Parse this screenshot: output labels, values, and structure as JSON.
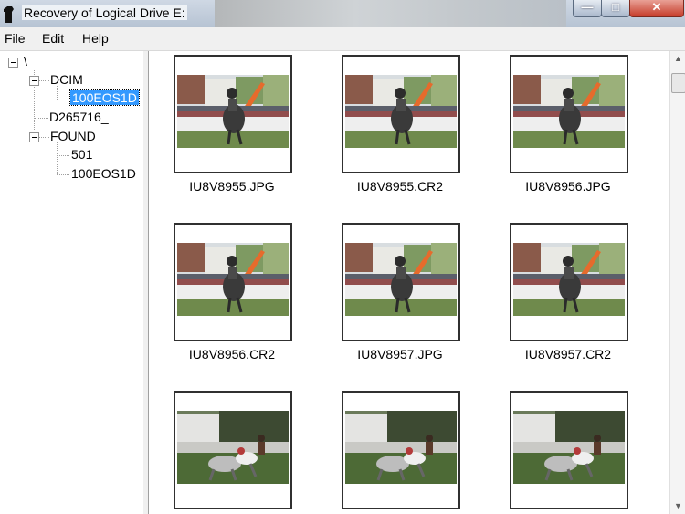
{
  "window": {
    "title": "Recovery of Logical Drive E:",
    "minimize_glyph": "—",
    "maximize_glyph": "□",
    "close_glyph": "✕"
  },
  "menu": {
    "items": [
      "File",
      "Edit",
      "Help"
    ]
  },
  "tree": {
    "root": "\\",
    "dcim": "DCIM",
    "dcim_child": "100EOS1D",
    "d265716": "D265716_",
    "found": "FOUND",
    "found_child_1": "501",
    "found_child_2": "100EOS1D"
  },
  "files": [
    {
      "name": "IU8V8955.JPG",
      "scene": "rider"
    },
    {
      "name": "IU8V8955.CR2",
      "scene": "rider"
    },
    {
      "name": "IU8V8956.JPG",
      "scene": "rider"
    },
    {
      "name": "IU8V8956.CR2",
      "scene": "rider"
    },
    {
      "name": "IU8V8957.JPG",
      "scene": "rider"
    },
    {
      "name": "IU8V8957.CR2",
      "scene": "rider"
    },
    {
      "name": "",
      "scene": "horses"
    },
    {
      "name": "",
      "scene": "horses"
    },
    {
      "name": "",
      "scene": "horses"
    }
  ],
  "scrollbar": {
    "up_glyph": "▲",
    "down_glyph": "▼"
  }
}
